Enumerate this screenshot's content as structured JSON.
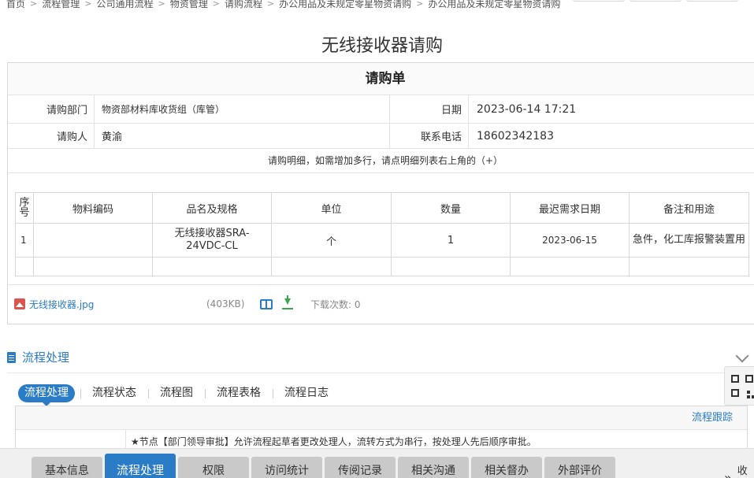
{
  "breadcrumb": [
    "首页",
    "流程管理",
    "公司通用流程",
    "物资管理",
    "请购流程",
    "办公用品及未规定零星物资请购",
    "办公用品及未规定零星物资请购"
  ],
  "page_title": "无线接收器请购",
  "form": {
    "header": "请购单",
    "dept_label": "请购部门",
    "dept_value": "物资部材料库收货组（库管）",
    "date_label": "日期",
    "date_value": "2023-06-14 17:21",
    "requester_label": "请购人",
    "requester_value": "黄渝",
    "phone_label": "联系电话",
    "phone_value": "18602342183",
    "detail_note": "请购明细，如需增加多行，请点明细列表右上角的（+）"
  },
  "table": {
    "headers": [
      "序号",
      "物料编码",
      "品名及规格",
      "单位",
      "数量",
      "最迟需求日期",
      "备注和用途"
    ],
    "rows": [
      [
        "1",
        "",
        "无线接收器SRA-24VDC-CL",
        "个",
        "1",
        "2023-06-15",
        "急件，化工库报警装置用"
      ]
    ]
  },
  "attachment": {
    "file_name": "无线接收器.jpg",
    "file_size": "(403KB)",
    "download_count": "下载次数: 0"
  },
  "process": {
    "section_title": "流程处理",
    "tabs": [
      "流程处理",
      "流程状态",
      "流程图",
      "流程表格",
      "流程日志"
    ],
    "track_link": "流程跟踪",
    "node_text": "★节点【部门领导审批】允许流程起草者更改处理人，流转方式为串行，按处理人先后顺序审批。"
  },
  "bottom_tabs": [
    "基本信息",
    "流程处理",
    "权限",
    "访问统计",
    "传阅记录",
    "相关沟通",
    "相关督办",
    "外部评价"
  ],
  "bottom_collapse": "收起",
  "colors": {
    "accent": "#2a7cc7",
    "download": "#3aa84a",
    "file": "#d9534f"
  }
}
